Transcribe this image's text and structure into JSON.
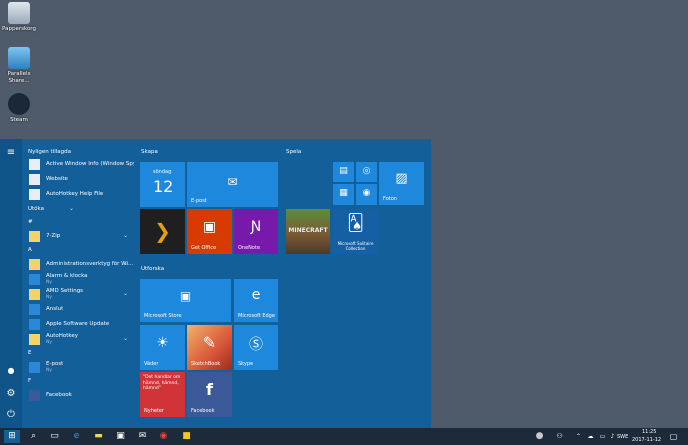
{
  "desktop": {
    "icons": [
      {
        "label": "Papperskorg",
        "icon": "recycle-bin-icon"
      },
      {
        "label": "Parallels Share...",
        "icon": "parallels-share-icon"
      },
      {
        "label": "Steam",
        "icon": "steam-icon"
      }
    ]
  },
  "start_menu": {
    "recent_header": "Nyligen tillagda",
    "recent": [
      {
        "label": "Active Window Info (Window Spy)"
      },
      {
        "label": "Website"
      },
      {
        "label": "AutoHotkey Help File"
      }
    ],
    "expand_label": "Utöka",
    "sections": [
      {
        "letter": "#",
        "apps": [
          {
            "label": "7-Zip",
            "sub": ""
          }
        ]
      },
      {
        "letter": "A",
        "apps": [
          {
            "label": "Administrationsverktyg för Wi...",
            "sub": ""
          },
          {
            "label": "Alarm & klocka",
            "sub": "Ny"
          },
          {
            "label": "AMD Settings",
            "sub": "Ny"
          },
          {
            "label": "Anslut",
            "sub": ""
          },
          {
            "label": "Apple Software Update",
            "sub": ""
          },
          {
            "label": "AutoHotkey",
            "sub": "Ny"
          }
        ]
      },
      {
        "letter": "E",
        "apps": [
          {
            "label": "E-post",
            "sub": "Ny"
          }
        ]
      },
      {
        "letter": "F",
        "apps": [
          {
            "label": "Facebook",
            "sub": ""
          }
        ]
      }
    ],
    "groups": {
      "skapa": "Skapa",
      "spela": "Spela",
      "utforska": "Utforska"
    },
    "tiles": {
      "calendar_day": "söndag",
      "calendar_date": "12",
      "mail": "E-post",
      "get_office": "Get Office",
      "onenote": "OneNote",
      "photos": "Foton",
      "solitaire": "Microsoft Solitaire Collection",
      "store": "Microsoft Store",
      "edge": "Microsoft Edge",
      "weather": "Väder",
      "sketchbook": "SketchBook",
      "skype": "Skype",
      "news_text": "\"Det handlar om hämnd, hämnd, hämnd\"",
      "news": "Nyheter",
      "facebook": "Facebook"
    }
  },
  "taskbar": {
    "language": "SWE",
    "time": "11:25",
    "date": "2017-11-12"
  }
}
